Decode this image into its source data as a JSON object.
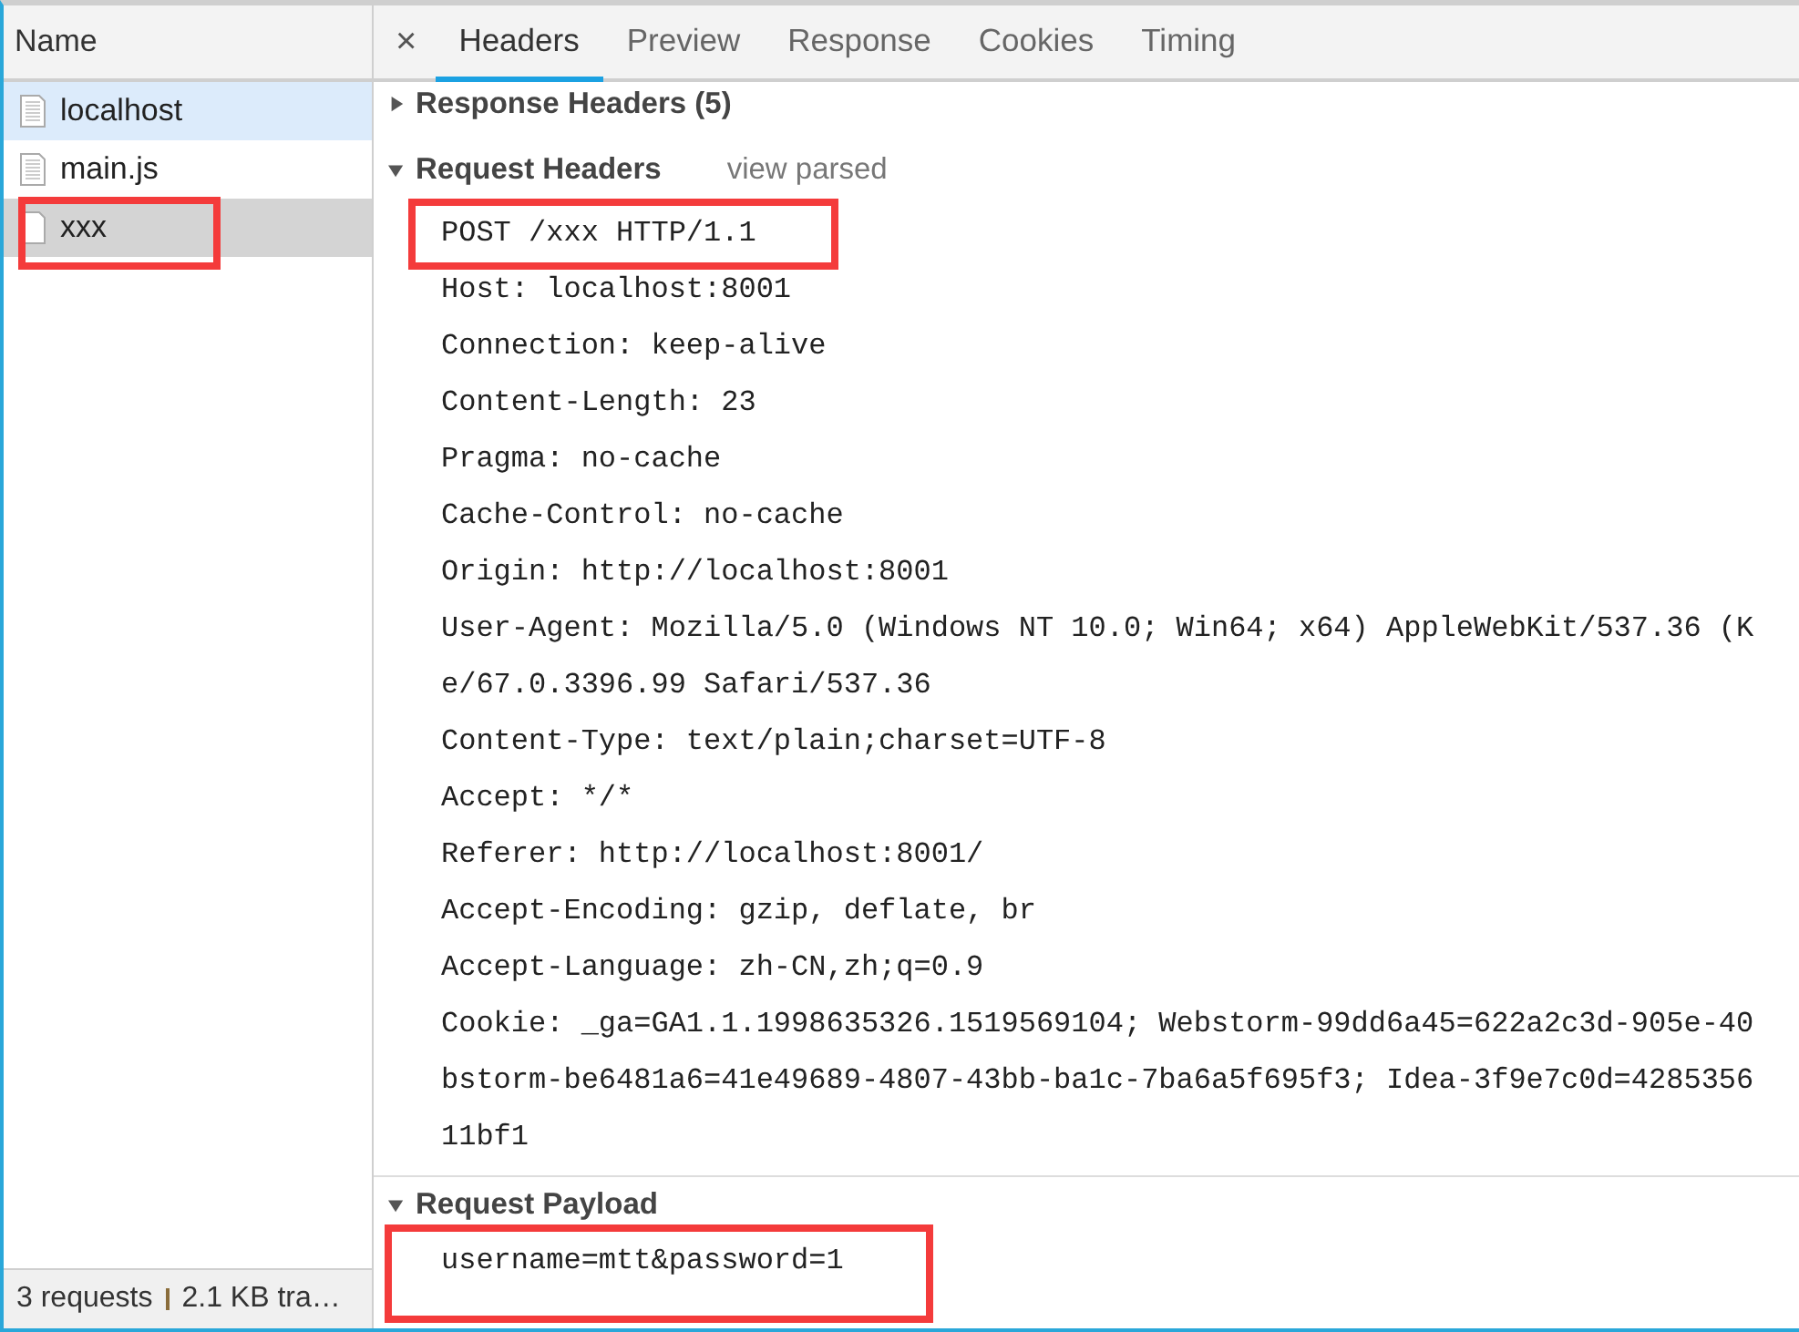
{
  "name_column": {
    "title": "Name"
  },
  "requests": [
    {
      "name": "localhost",
      "kind": "document",
      "selected": false,
      "hovered": true,
      "highlighted": false
    },
    {
      "name": "main.js",
      "kind": "document",
      "selected": false,
      "hovered": false,
      "highlighted": false
    },
    {
      "name": "xxx",
      "kind": "blank",
      "selected": true,
      "hovered": false,
      "highlighted": true
    }
  ],
  "close_tab": "×",
  "tabs": [
    {
      "label": "Headers",
      "selected": true
    },
    {
      "label": "Preview",
      "selected": false
    },
    {
      "label": "Response",
      "selected": false
    },
    {
      "label": "Cookies",
      "selected": false
    },
    {
      "label": "Timing",
      "selected": false
    }
  ],
  "sections": [
    {
      "title": "Response Headers (5)",
      "expanded": false
    },
    {
      "title": "Request Headers",
      "expanded": true,
      "link": "view parsed",
      "lines": [
        {
          "text": "POST /xxx HTTP/1.1",
          "highlighted": true
        },
        {
          "text": "Host: localhost:8001",
          "highlighted": false
        },
        {
          "text": "Connection: keep-alive",
          "highlighted": false
        },
        {
          "text": "Content-Length: 23",
          "highlighted": false
        },
        {
          "text": "Pragma: no-cache",
          "highlighted": false
        },
        {
          "text": "Cache-Control: no-cache",
          "highlighted": false
        },
        {
          "text": "Origin: http://localhost:8001",
          "highlighted": false
        },
        {
          "text": "User-Agent: Mozilla/5.0 (Windows NT 10.0; Win64; x64) AppleWebKit/537.36 (K",
          "highlighted": false
        },
        {
          "text": "e/67.0.3396.99 Safari/537.36",
          "highlighted": false
        },
        {
          "text": "Content-Type: text/plain;charset=UTF-8",
          "highlighted": false
        },
        {
          "text": "Accept: */*",
          "highlighted": false
        },
        {
          "text": "Referer: http://localhost:8001/",
          "highlighted": false
        },
        {
          "text": "Accept-Encoding: gzip, deflate, br",
          "highlighted": false
        },
        {
          "text": "Accept-Language: zh-CN,zh;q=0.9",
          "highlighted": false
        },
        {
          "text": "Cookie: _ga=GA1.1.1998635326.1519569104; Webstorm-99dd6a45=622a2c3d-905e-40",
          "highlighted": false
        },
        {
          "text": "bstorm-be6481a6=41e49689-4807-43bb-ba1c-7ba6a5f695f3; Idea-3f9e7c0d=4285356",
          "highlighted": false
        },
        {
          "text": "11bf1",
          "highlighted": false
        }
      ]
    },
    {
      "title": "Request Payload",
      "expanded": true,
      "lines": [
        {
          "text": "username=mtt&password=1",
          "highlighted": true
        }
      ]
    }
  ],
  "status_bar": [
    "3 requests",
    "2.1 KB tra…"
  ]
}
